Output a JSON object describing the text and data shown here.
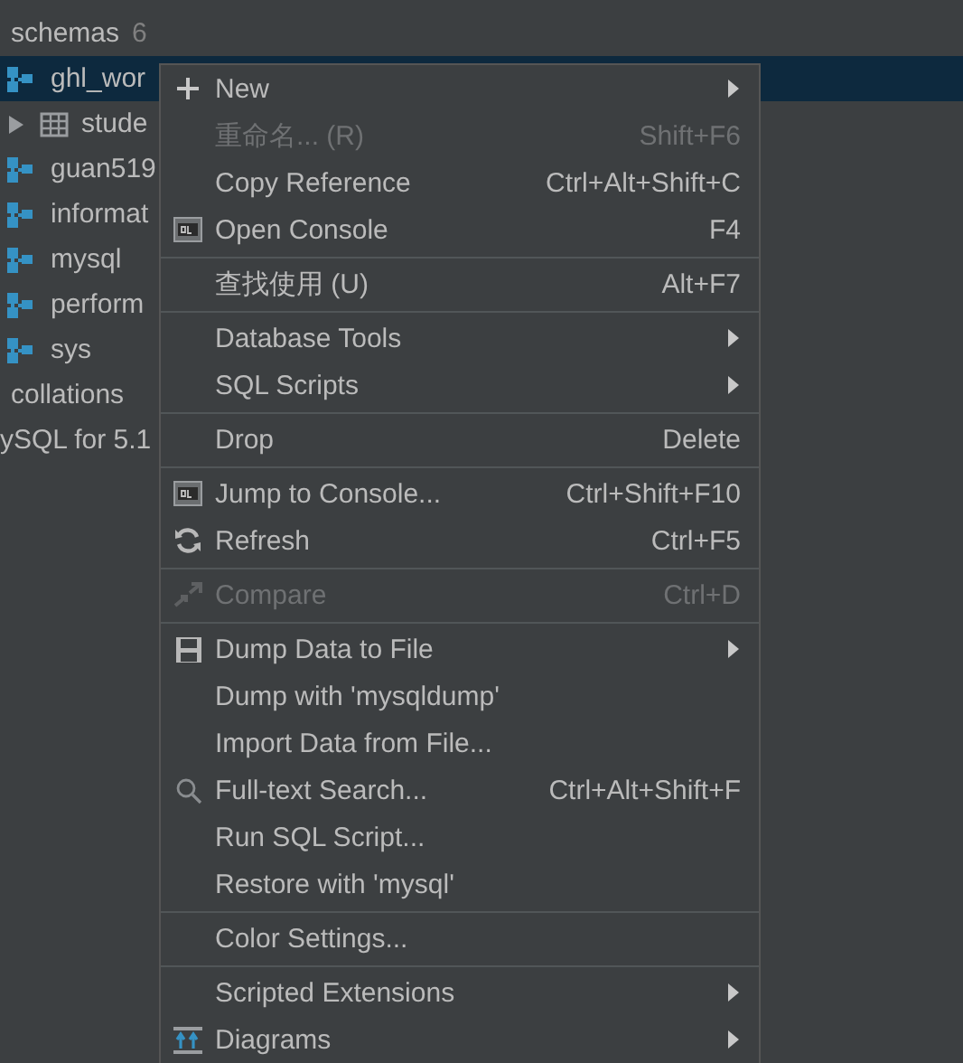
{
  "tree": [
    {
      "kind": "folder",
      "label": "schemas",
      "count": "6",
      "selected": false
    },
    {
      "kind": "schema",
      "label": "ghl_wor",
      "selected": true
    },
    {
      "kind": "table",
      "label": "stude",
      "selected": false
    },
    {
      "kind": "schema",
      "label": "guan519",
      "selected": false
    },
    {
      "kind": "schema",
      "label": "informat",
      "selected": false
    },
    {
      "kind": "schema",
      "label": "mysql",
      "selected": false
    },
    {
      "kind": "schema",
      "label": "perform",
      "selected": false
    },
    {
      "kind": "schema",
      "label": "sys",
      "selected": false
    },
    {
      "kind": "folder",
      "label": "collations",
      "selected": false
    },
    {
      "kind": "root",
      "label": "ySQL for 5.1",
      "selected": false
    }
  ],
  "context_menu": [
    {
      "kind": "item",
      "label": "New",
      "submenu": true,
      "disabled": false
    },
    {
      "kind": "item",
      "label": "重命名... (R)",
      "shortcut": "Shift+F6",
      "submenu": false,
      "disabled": true
    },
    {
      "kind": "item",
      "label": "Copy Reference",
      "shortcut": "Ctrl+Alt+Shift+C",
      "submenu": false,
      "disabled": false
    },
    {
      "kind": "item",
      "label": "Open Console",
      "shortcut": "F4",
      "submenu": false,
      "disabled": false
    },
    {
      "kind": "separator"
    },
    {
      "kind": "item",
      "label": "查找使用 (U)",
      "shortcut": "Alt+F7",
      "submenu": false,
      "disabled": false
    },
    {
      "kind": "separator"
    },
    {
      "kind": "item",
      "label": "Database Tools",
      "submenu": true,
      "disabled": false
    },
    {
      "kind": "item",
      "label": "SQL Scripts",
      "submenu": true,
      "disabled": false
    },
    {
      "kind": "separator"
    },
    {
      "kind": "item",
      "label": "Drop",
      "shortcut": "Delete",
      "submenu": false,
      "disabled": false
    },
    {
      "kind": "separator"
    },
    {
      "kind": "item",
      "label": "Jump to Console...",
      "shortcut": "Ctrl+Shift+F10",
      "submenu": false,
      "disabled": false
    },
    {
      "kind": "item",
      "label": "Refresh",
      "shortcut": "Ctrl+F5",
      "submenu": false,
      "disabled": false
    },
    {
      "kind": "separator"
    },
    {
      "kind": "item",
      "label": "Compare",
      "shortcut": "Ctrl+D",
      "submenu": false,
      "disabled": true
    },
    {
      "kind": "separator"
    },
    {
      "kind": "item",
      "label": "Dump Data to File",
      "submenu": true,
      "disabled": false
    },
    {
      "kind": "item",
      "label": "Dump with 'mysqldump'",
      "submenu": false,
      "disabled": false
    },
    {
      "kind": "item",
      "label": "Import Data from File...",
      "submenu": false,
      "disabled": false
    },
    {
      "kind": "item",
      "label": "Full-text Search...",
      "shortcut": "Ctrl+Alt+Shift+F",
      "submenu": false,
      "disabled": false
    },
    {
      "kind": "item",
      "label": "Run SQL Script...",
      "submenu": false,
      "disabled": false
    },
    {
      "kind": "item",
      "label": "Restore with 'mysql'",
      "submenu": false,
      "disabled": false
    },
    {
      "kind": "separator"
    },
    {
      "kind": "item",
      "label": "Color Settings...",
      "submenu": false,
      "disabled": false
    },
    {
      "kind": "separator"
    },
    {
      "kind": "item",
      "label": "Scripted Extensions",
      "submenu": true,
      "disabled": false
    },
    {
      "kind": "item",
      "label": "Diagrams",
      "submenu": true,
      "disabled": false
    }
  ]
}
